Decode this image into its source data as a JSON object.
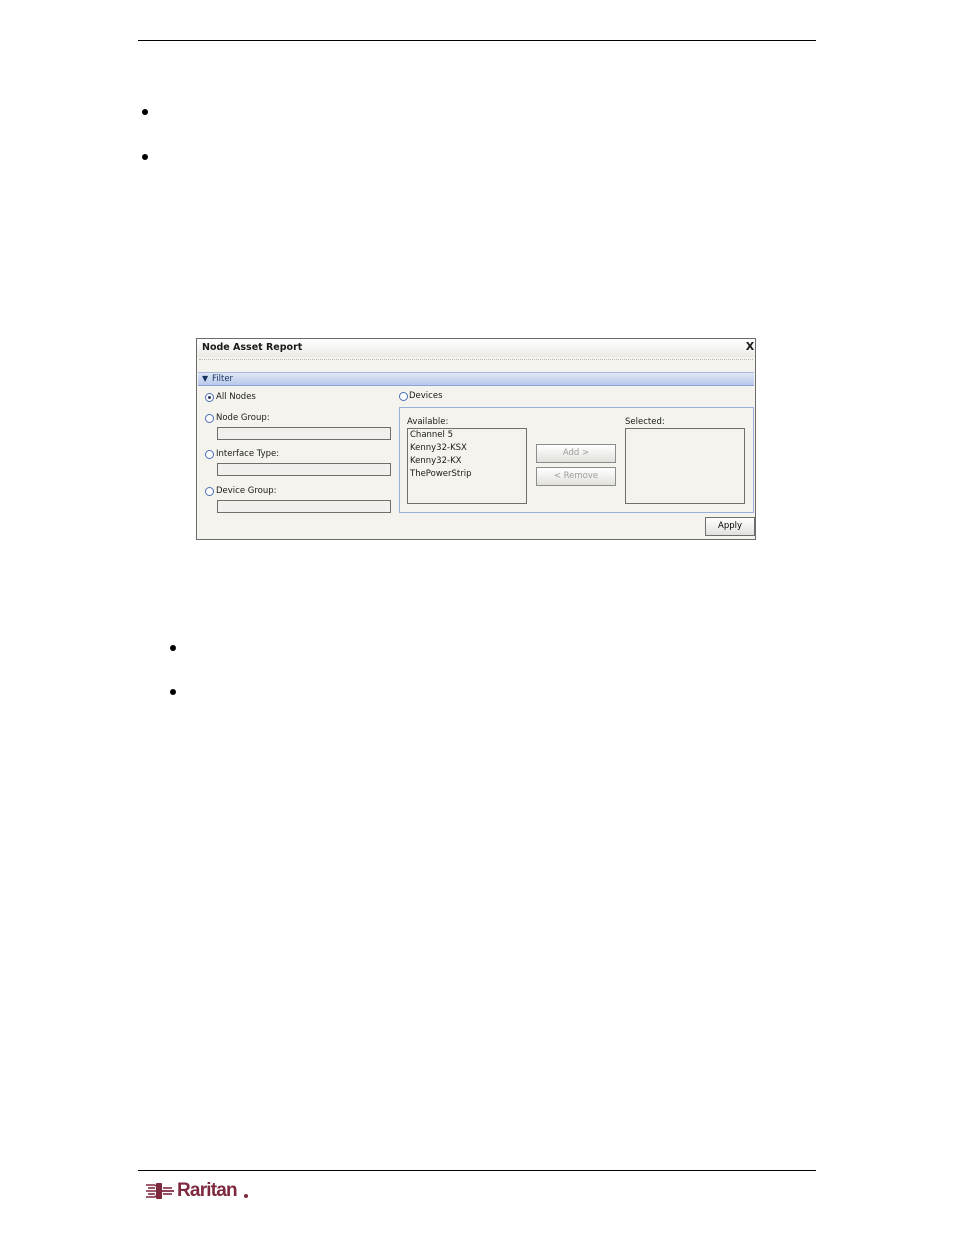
{
  "dialog": {
    "title": "Node Asset Report",
    "close_glyph": "X",
    "filter_arrow_glyph": "▼",
    "filter_label": "Filter",
    "left_options": [
      {
        "label": "All Nodes",
        "checked": true
      },
      {
        "label": "Node Group:",
        "checked": false
      },
      {
        "label": "Interface Type:",
        "checked": false
      },
      {
        "label": "Device Group:",
        "checked": false
      }
    ],
    "devices_option": {
      "label": "Devices",
      "checked": false
    },
    "available_label": "Available:",
    "available_items": [
      "Channel 5",
      "Kenny32-KSX",
      "Kenny32-KX",
      "ThePowerStrip"
    ],
    "selected_label": "Selected:",
    "add_button": "Add  >",
    "remove_button": "<  Remove",
    "apply_button": "Apply"
  },
  "footer": {
    "logo_text": "Raritan",
    "logo_color": "#7d2a3e"
  }
}
